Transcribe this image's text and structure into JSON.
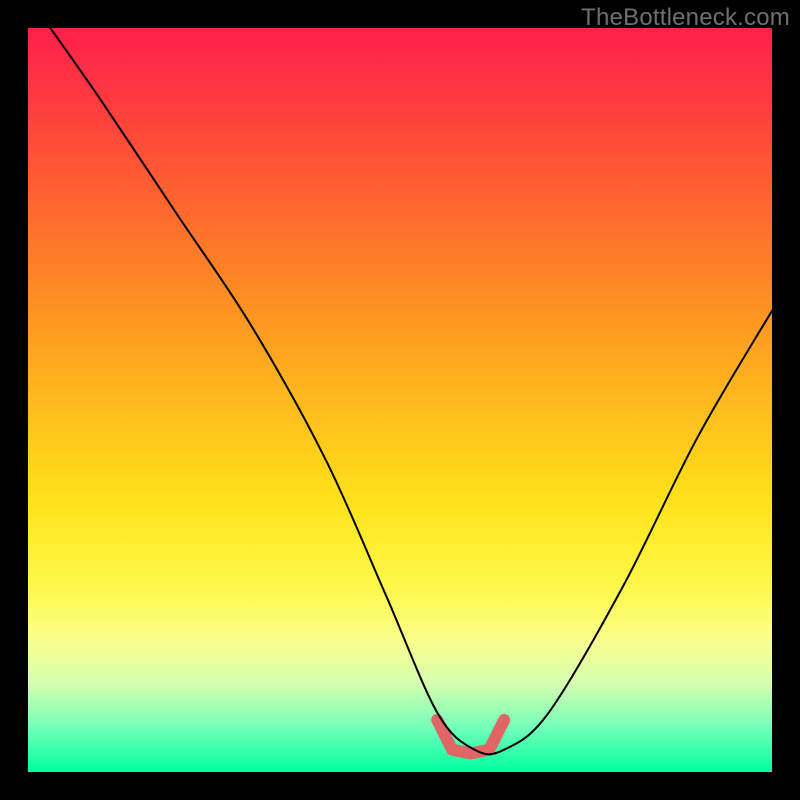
{
  "watermark": "TheBottleneck.com",
  "colors": {
    "flat_band": "#e06666",
    "curve": "#000000",
    "gradient_top": "#ff1f4a",
    "gradient_bottom": "#00ffa0",
    "frame": "#000000"
  },
  "chart_data": {
    "type": "line",
    "title": "",
    "xlabel": "",
    "ylabel": "",
    "xlim": [
      0,
      100
    ],
    "ylim": [
      0,
      100
    ],
    "grid": false,
    "legend": false,
    "series": [
      {
        "name": "bottleneck-curve",
        "x": [
          3,
          10,
          20,
          30,
          40,
          48,
          55,
          60,
          64,
          70,
          80,
          90,
          100
        ],
        "values": [
          100,
          90,
          75,
          60,
          42,
          24,
          8,
          3,
          3,
          8,
          25,
          45,
          62
        ]
      }
    ],
    "annotations": [
      {
        "name": "optimal-flat-region",
        "x_start": 55,
        "x_end": 64,
        "y": 3
      }
    ]
  }
}
